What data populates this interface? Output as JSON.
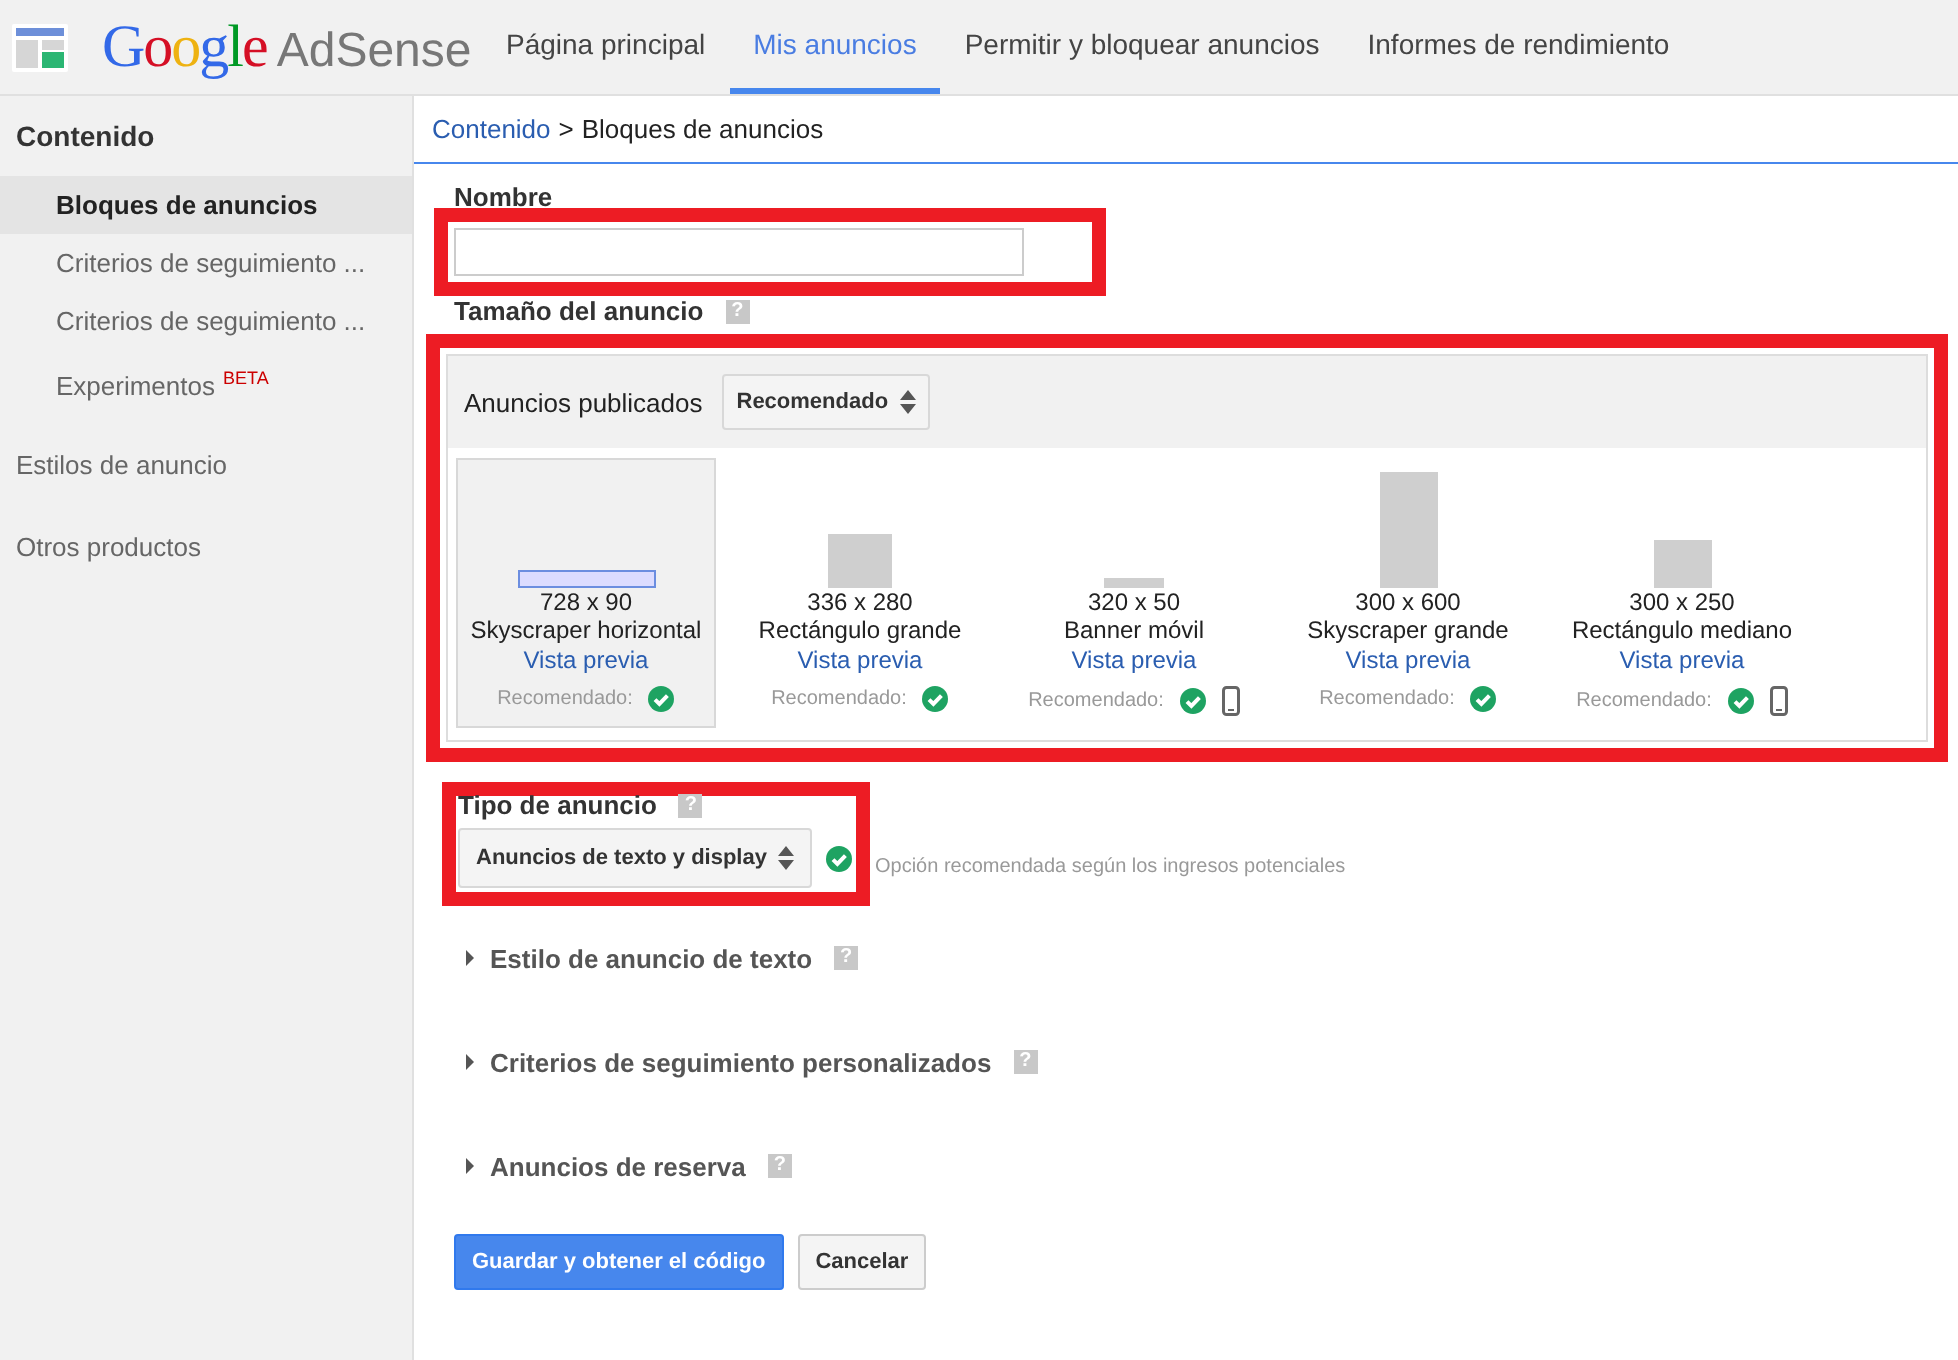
{
  "header": {
    "logo_google": "Google",
    "logo_product": "AdSense",
    "nav": [
      {
        "label": "Página principal",
        "selected": false
      },
      {
        "label": "Mis anuncios",
        "selected": true
      },
      {
        "label": "Permitir y bloquear anuncios",
        "selected": false
      },
      {
        "label": "Informes de rendimiento",
        "selected": false
      }
    ]
  },
  "sidebar": {
    "heading": "Contenido",
    "items": [
      {
        "label": "Bloques de anuncios",
        "selected": true
      },
      {
        "label": "Criterios de seguimiento ...",
        "selected": false
      },
      {
        "label": "Criterios de seguimiento ...",
        "selected": false
      },
      {
        "label": "Experimentos",
        "badge": "BETA",
        "selected": false
      }
    ],
    "sections": [
      "Estilos de anuncio",
      "Otros productos"
    ]
  },
  "breadcrumb": {
    "link": "Contenido",
    "separator": ">",
    "current": "Bloques de anuncios"
  },
  "name_field": {
    "label": "Nombre",
    "highlighted": true
  },
  "ad_size": {
    "label": "Tamaño del anuncio",
    "help": "?",
    "highlighted": true,
    "filter_label": "Anuncios publicados",
    "filter_value": "Recomendado",
    "sizes": [
      {
        "dimensions": "728 x 90",
        "name": "Skyscraper horizontal",
        "preview": "Vista previa",
        "recommended": "Recomendado:",
        "selected": true,
        "mobile": false
      },
      {
        "dimensions": "336 x 280",
        "name": "Rectángulo grande",
        "preview": "Vista previa",
        "recommended": "Recomendado:",
        "selected": false,
        "mobile": false
      },
      {
        "dimensions": "320 x 50",
        "name": "Banner móvil",
        "preview": "Vista previa",
        "recommended": "Recomendado:",
        "selected": false,
        "mobile": true
      },
      {
        "dimensions": "300 x 600",
        "name": "Skyscraper grande",
        "preview": "Vista previa",
        "recommended": "Recomendado:",
        "selected": false,
        "mobile": false
      },
      {
        "dimensions": "300 x 250",
        "name": "Rectángulo mediano",
        "preview": "Vista previa",
        "recommended": "Recomendado:",
        "selected": false,
        "mobile": true
      }
    ]
  },
  "ad_type": {
    "label": "Tipo de anuncio",
    "help": "?",
    "highlighted": true,
    "value": "Anuncios de texto y display",
    "note": "Opción recomendada según los ingresos potenciales"
  },
  "sections": [
    {
      "label": "Estilo de anuncio de texto",
      "help": "?",
      "expanded": false
    },
    {
      "label": "Criterios de seguimiento personalizados",
      "help": "?",
      "expanded": false
    },
    {
      "label": "Anuncios de reserva",
      "help": "?",
      "expanded": false
    }
  ],
  "buttons": [
    {
      "label": "Guardar y obtener el código",
      "kind": "primary"
    },
    {
      "label": "Cancelar",
      "kind": "secondary"
    }
  ]
}
